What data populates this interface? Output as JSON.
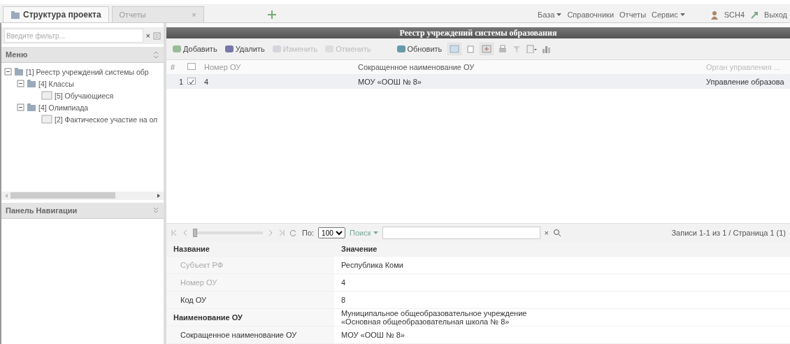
{
  "tabs": [
    {
      "label": "Структура проекта",
      "selected": true
    },
    {
      "label": "Отчеты",
      "selected": false,
      "close": "×"
    }
  ],
  "top_menu": [
    {
      "label": "База",
      "dropdown": true
    },
    {
      "label": "Справочники",
      "dropdown": false
    },
    {
      "label": "Отчеты",
      "dropdown": false
    },
    {
      "label": "Сервис",
      "dropdown": true
    }
  ],
  "user": "SCH4",
  "logout": "Выход",
  "filter": {
    "placeholder": "Введите фильтр...",
    "clear": "×"
  },
  "menu": {
    "title": "Меню",
    "items": [
      {
        "label": "[1] Реестр учреждений системы обр",
        "expanded": true,
        "children": [
          {
            "label": "[4] Классы",
            "expanded": true,
            "children": [
              {
                "label": "[5] Обучающиеся"
              }
            ]
          },
          {
            "label": "[4] Олимпиада",
            "expanded": true,
            "children": [
              {
                "label": "[2] Фактическое участие на ол"
              }
            ]
          }
        ]
      }
    ]
  },
  "nav_panel": {
    "title": "Панель Навигации"
  },
  "window": {
    "title": "Реестр учреждений системы образования"
  },
  "toolbar": [
    {
      "label": "Добавить",
      "disabled": false
    },
    {
      "label": "Удалить",
      "disabled": false
    },
    {
      "label": "Изменить",
      "disabled": true
    },
    {
      "label": "Отменить",
      "disabled": true
    },
    {
      "label": "Обновить",
      "disabled": false
    }
  ],
  "table": {
    "columns": [
      {
        "label": "#",
        "kind": "index"
      },
      {
        "kind": "check",
        "checked": false
      },
      {
        "label": "Номер ОУ",
        "kind": "text"
      },
      {
        "label": "Сокращенное наименование ОУ",
        "kind": "text"
      },
      {
        "label": "Орган управления ...",
        "kind": "text"
      }
    ],
    "rows": [
      {
        "selected": true,
        "checked": true,
        "cells": [
          "1",
          "",
          "4",
          "МОУ «ООШ № 8»",
          "Управление образова"
        ]
      }
    ]
  },
  "pager": {
    "level": 0,
    "page_size_label": "По:",
    "page_size": "100",
    "search_label": "Поиск",
    "search_clear": "×",
    "summary": "Записи 1-1 из 1 / Страница 1 (1)"
  },
  "properties": {
    "columns": [
      "Название",
      "Значение"
    ],
    "rows": [
      {
        "name": "Субъект РФ",
        "value": "Республика Коми",
        "disabled": true,
        "required": false
      },
      {
        "name": "Номер ОУ",
        "value": "4",
        "disabled": true,
        "required": false
      },
      {
        "name": "Код ОУ",
        "value": "8",
        "disabled": false,
        "required": false
      },
      {
        "name": "Наименование ОУ",
        "value": "Муниципальное общеобразовательное учреждение «Основная общеобразовательная школа № 8»",
        "disabled": false,
        "required": true
      },
      {
        "name": "Сокращенное наименование ОУ",
        "value": "МОУ «ООШ № 8»",
        "disabled": false,
        "required": false
      }
    ]
  }
}
